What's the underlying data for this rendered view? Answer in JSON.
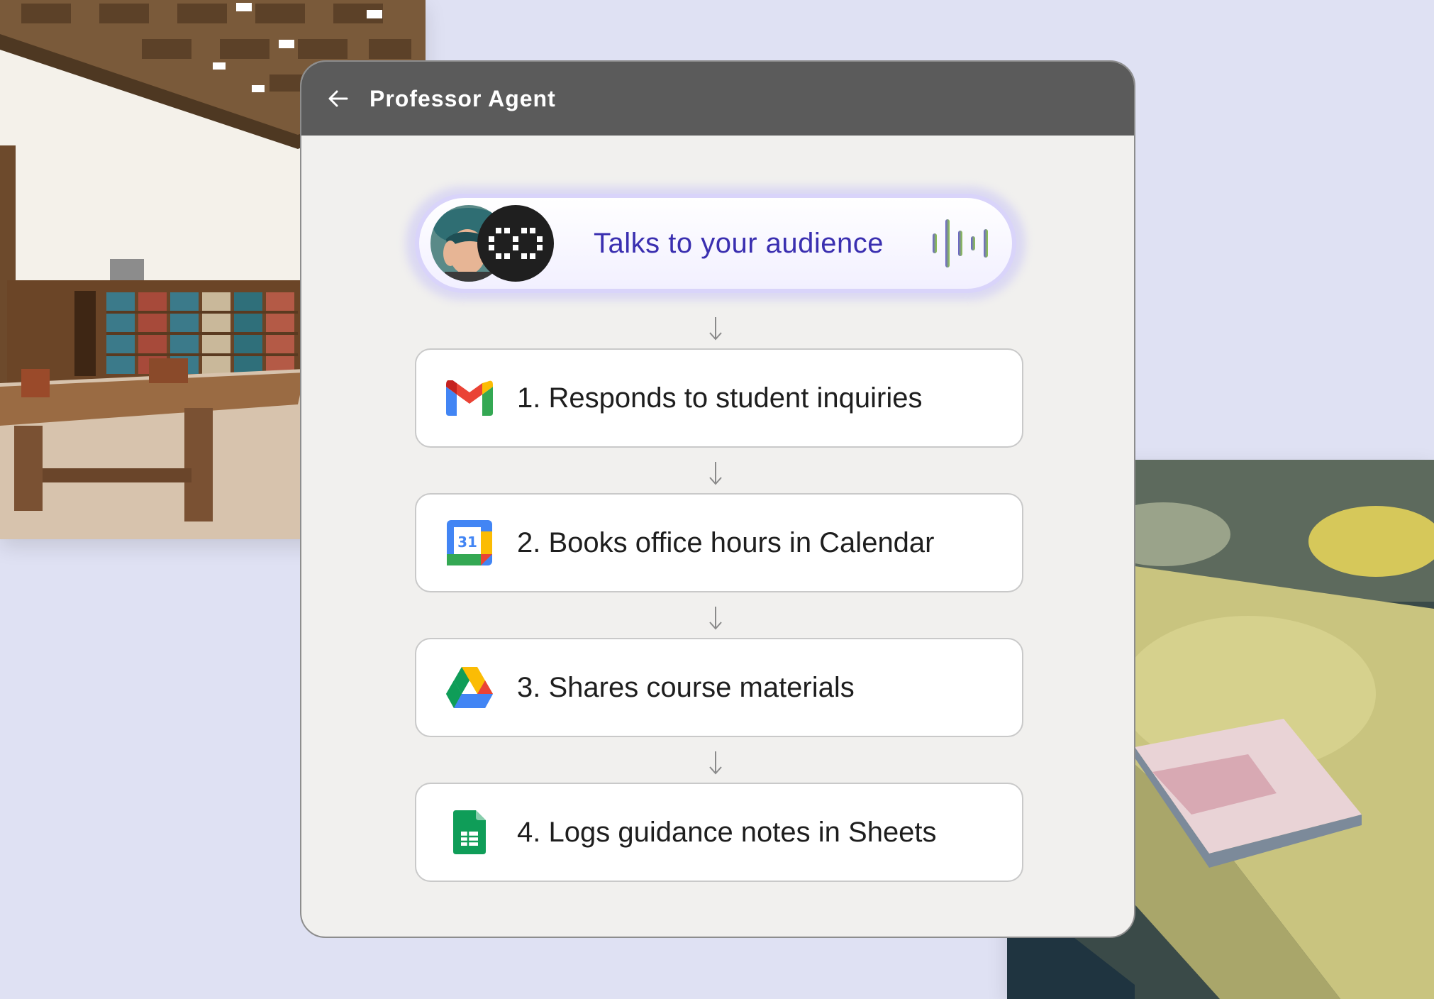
{
  "window": {
    "title": "Professor Agent"
  },
  "audience": {
    "label": "Talks to your audience"
  },
  "steps": [
    {
      "label": "1. Responds to student inquiries",
      "icon": "gmail-icon"
    },
    {
      "label": "2. Books office hours in Calendar",
      "icon": "google-calendar-icon",
      "icon_text": "31"
    },
    {
      "label": "3. Shares course materials",
      "icon": "google-drive-icon"
    },
    {
      "label": "4. Logs guidance notes in Sheets",
      "icon": "google-sheets-icon"
    }
  ],
  "colors": {
    "page_background": "#dfe1f3",
    "titlebar": "#5b5b5b",
    "window_background": "#f1f0ee",
    "pill_text": "#3a2fb0",
    "pill_border": "#d9d4fa"
  }
}
